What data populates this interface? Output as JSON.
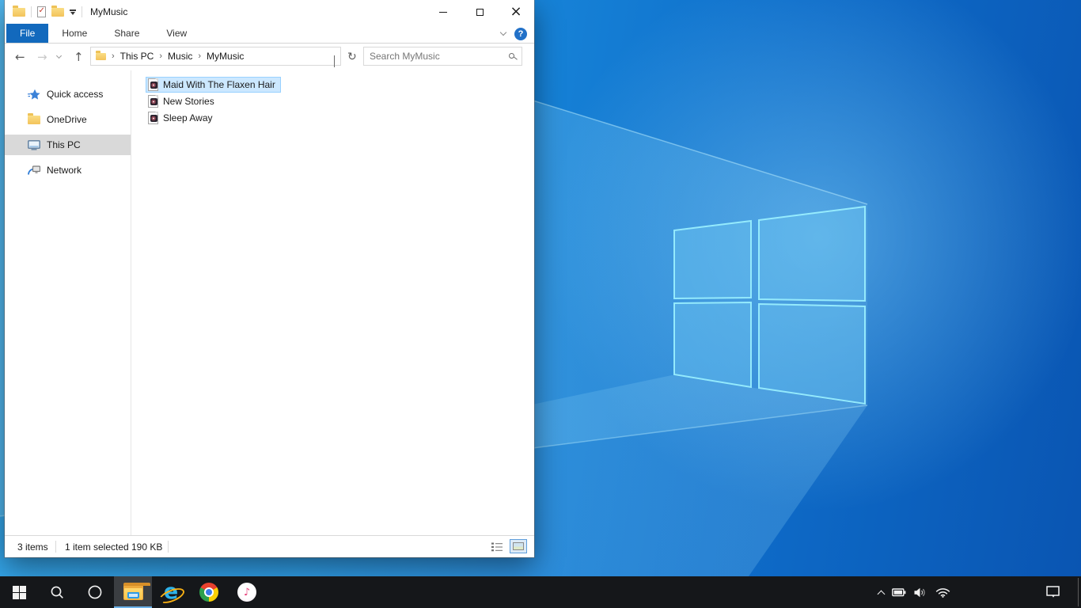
{
  "explorer": {
    "title": "MyMusic",
    "ribbon": {
      "tabs": [
        {
          "label": "File",
          "active": true
        },
        {
          "label": "Home",
          "active": false
        },
        {
          "label": "Share",
          "active": false
        },
        {
          "label": "View",
          "active": false
        }
      ],
      "help_glyph": "?"
    },
    "addressbar": {
      "breadcrumb": [
        "This PC",
        "Music",
        "MyMusic"
      ],
      "search_placeholder": "Search MyMusic"
    },
    "sidebar": {
      "items": [
        {
          "label": "Quick access",
          "icon": "quick-access-star-icon",
          "selected": false
        },
        {
          "label": "OneDrive",
          "icon": "onedrive-folder-icon",
          "selected": false
        },
        {
          "label": "This PC",
          "icon": "this-pc-monitor-icon",
          "selected": true
        },
        {
          "label": "Network",
          "icon": "network-icon",
          "selected": false
        }
      ]
    },
    "files": {
      "items": [
        {
          "name": "Maid With The Flaxen Hair",
          "icon": "music-file-icon",
          "selected": true
        },
        {
          "name": "New Stories",
          "icon": "music-file-icon",
          "selected": false
        },
        {
          "name": "Sleep Away",
          "icon": "music-file-icon",
          "selected": false
        }
      ]
    },
    "statusbar": {
      "item_count": "3 items",
      "selection": "1 item selected",
      "selection_size": "190 KB",
      "active_view": "large-icons-view"
    }
  },
  "icons": {
    "back": "←",
    "forward": "→",
    "up": "↑",
    "refresh": "↻",
    "close": "×",
    "crumb_separator": "›",
    "properties_check": "✓",
    "itunes_note": "♪"
  },
  "taskbar": {
    "buttons": [
      {
        "name": "start",
        "active": false
      },
      {
        "name": "search",
        "active": false
      },
      {
        "name": "cortana",
        "active": false
      },
      {
        "name": "file-explorer",
        "active": true
      },
      {
        "name": "internet-explorer",
        "active": false
      },
      {
        "name": "chrome",
        "active": false
      },
      {
        "name": "itunes",
        "active": false
      }
    ],
    "tray": [
      "hidden-icons-chevron",
      "battery",
      "volume",
      "wifi"
    ],
    "action_center": "action-center"
  },
  "colors": {
    "accent_tab": "#1269bd",
    "file_selection_bg": "#cce8ff",
    "file_selection_border": "#99d1ff",
    "sidebar_selection": "#d9d9d9",
    "taskbar_bg": "#15171a",
    "taskbar_active_underline": "#6cb2e8",
    "wallpaper_base": "#1b8ede"
  }
}
